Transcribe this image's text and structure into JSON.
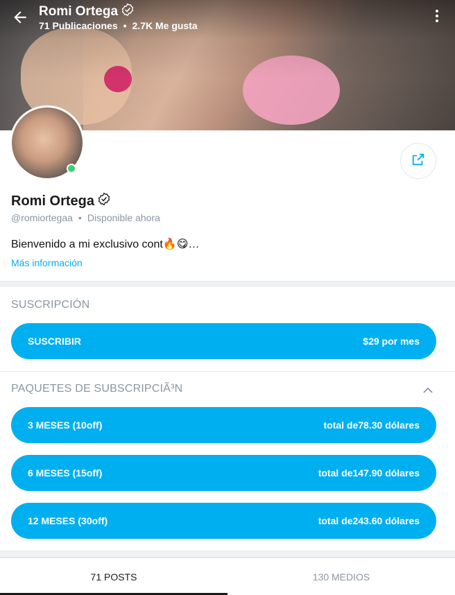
{
  "header": {
    "name": "Romi Ortega",
    "posts_count": "71 Publicaciones",
    "likes_count": "2.7K Me gusta",
    "separator": "•"
  },
  "profile": {
    "name": "Romi Ortega",
    "handle": "@romiortegaa",
    "status": "Disponible ahora",
    "separator": "•",
    "bio": "Bienvenido a mi exclusivo cont🔥😋…",
    "more_info": "Más información"
  },
  "subscription": {
    "title": "SUSCRIPCIÓN",
    "subscribe_label": "SUSCRIBIR",
    "price": "$29 por mes"
  },
  "bundles": {
    "title": "PAQUETES DE SUBSCRIPCIÃ³N",
    "items": [
      {
        "label": "3 MESES (10off)",
        "price": "total de78.30 dólares"
      },
      {
        "label": "6 MESES (15off)",
        "price": "total de147.90 dólares"
      },
      {
        "label": "12 MESES (30off)",
        "price": "total de243.60 dólares"
      }
    ]
  },
  "tabs": [
    {
      "label": "71 POSTS",
      "active": true
    },
    {
      "label": "130 MEDIOS",
      "active": false
    }
  ],
  "colors": {
    "accent": "#00aff0",
    "online": "#3bd16f",
    "muted": "#8a96a3"
  },
  "icons": [
    "back-arrow-icon",
    "verified-icon",
    "more-vertical-icon",
    "share-icon",
    "chevron-up-icon"
  ]
}
